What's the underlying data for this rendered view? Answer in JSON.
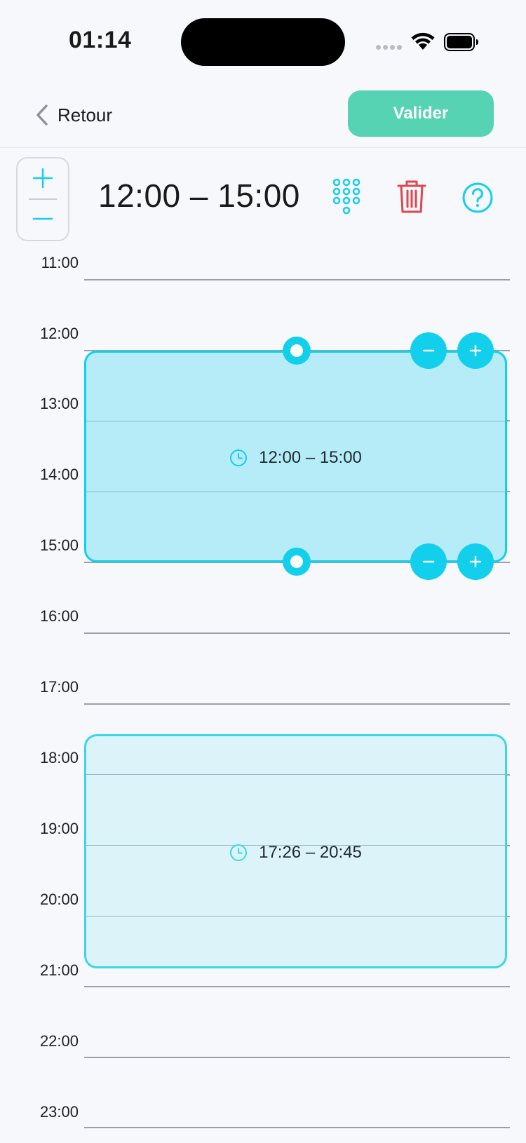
{
  "status_bar": {
    "time": "01:14"
  },
  "nav": {
    "back_label": "Retour",
    "validate_label": "Valider"
  },
  "toolbar": {
    "range_title": "12:00 – 15:00",
    "zoom_in_icon": "plus-icon",
    "zoom_out_icon": "minus-icon",
    "keypad_icon": "keypad-icon",
    "delete_icon": "trash-icon",
    "help_icon": "help-icon"
  },
  "timeline": {
    "hours": [
      "11:00",
      "12:00",
      "13:00",
      "14:00",
      "15:00",
      "16:00",
      "17:00",
      "18:00",
      "19:00",
      "20:00",
      "21:00",
      "22:00",
      "23:00"
    ]
  },
  "slots": [
    {
      "label": "12:00 – 15:00",
      "state": "selected"
    },
    {
      "label": "17:26 – 20:45",
      "state": "default"
    }
  ],
  "colors": {
    "accent": "#12cfec",
    "validate": "#55d3b2",
    "delete": "#e0454f",
    "selected_fill": "#b5ecf8",
    "other_fill": "#dcf4f9"
  }
}
